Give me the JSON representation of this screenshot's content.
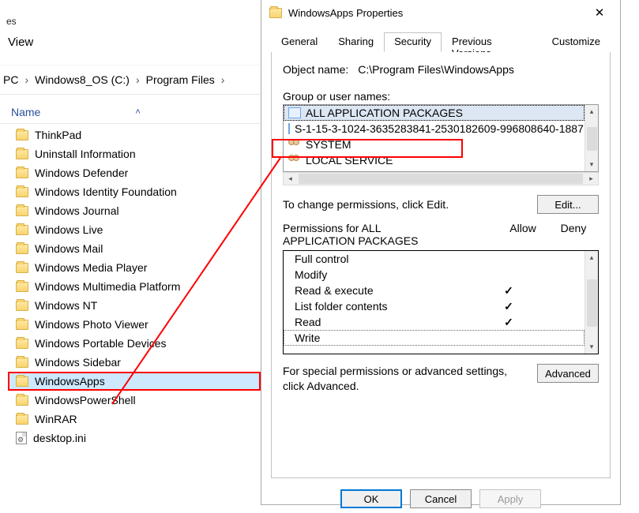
{
  "explorer": {
    "corner_label": "es",
    "menu_view": "View",
    "breadcrumbs": [
      "PC",
      "Windows8_OS (C:)",
      "Program Files"
    ],
    "column_header": "Name",
    "items": [
      {
        "name": "ThinkPad",
        "type": "folder"
      },
      {
        "name": "Uninstall Information",
        "type": "folder"
      },
      {
        "name": "Windows Defender",
        "type": "folder"
      },
      {
        "name": "Windows Identity Foundation",
        "type": "folder"
      },
      {
        "name": "Windows Journal",
        "type": "folder"
      },
      {
        "name": "Windows Live",
        "type": "folder"
      },
      {
        "name": "Windows Mail",
        "type": "folder"
      },
      {
        "name": "Windows Media Player",
        "type": "folder"
      },
      {
        "name": "Windows Multimedia Platform",
        "type": "folder"
      },
      {
        "name": "Windows NT",
        "type": "folder"
      },
      {
        "name": "Windows Photo Viewer",
        "type": "folder"
      },
      {
        "name": "Windows Portable Devices",
        "type": "folder"
      },
      {
        "name": "Windows Sidebar",
        "type": "folder"
      },
      {
        "name": "WindowsApps",
        "type": "folder",
        "selected": true
      },
      {
        "name": "WindowsPowerShell",
        "type": "folder"
      },
      {
        "name": "WinRAR",
        "type": "folder"
      },
      {
        "name": "desktop.ini",
        "type": "ini"
      }
    ]
  },
  "properties": {
    "title": "WindowsApps Properties",
    "tabs": [
      "General",
      "Sharing",
      "Security",
      "Previous Versions",
      "Customize"
    ],
    "active_tab": "Security",
    "object_label": "Object name:",
    "object_value": "C:\\Program Files\\WindowsApps",
    "group_label": "Group or user names:",
    "principals": [
      "ALL APPLICATION PACKAGES",
      "S-1-15-3-1024-3635283841-2530182609-996808640-1887",
      "SYSTEM",
      "LOCAL SERVICE"
    ],
    "edit_hint": "To change permissions, click Edit.",
    "edit_button": "Edit...",
    "perm_label_prefix": "Permissions for ALL",
    "perm_label_line2": "APPLICATION PACKAGES",
    "col_allow": "Allow",
    "col_deny": "Deny",
    "permissions": [
      {
        "name": "Full control",
        "allow": false,
        "deny": false
      },
      {
        "name": "Modify",
        "allow": false,
        "deny": false
      },
      {
        "name": "Read & execute",
        "allow": true,
        "deny": false
      },
      {
        "name": "List folder contents",
        "allow": true,
        "deny": false
      },
      {
        "name": "Read",
        "allow": true,
        "deny": false
      },
      {
        "name": "Write",
        "allow": false,
        "deny": false,
        "dotted": true
      }
    ],
    "advanced_text": "For special permissions or advanced settings, click Advanced.",
    "advanced_button": "Advanced",
    "ok": "OK",
    "cancel": "Cancel",
    "apply": "Apply"
  }
}
